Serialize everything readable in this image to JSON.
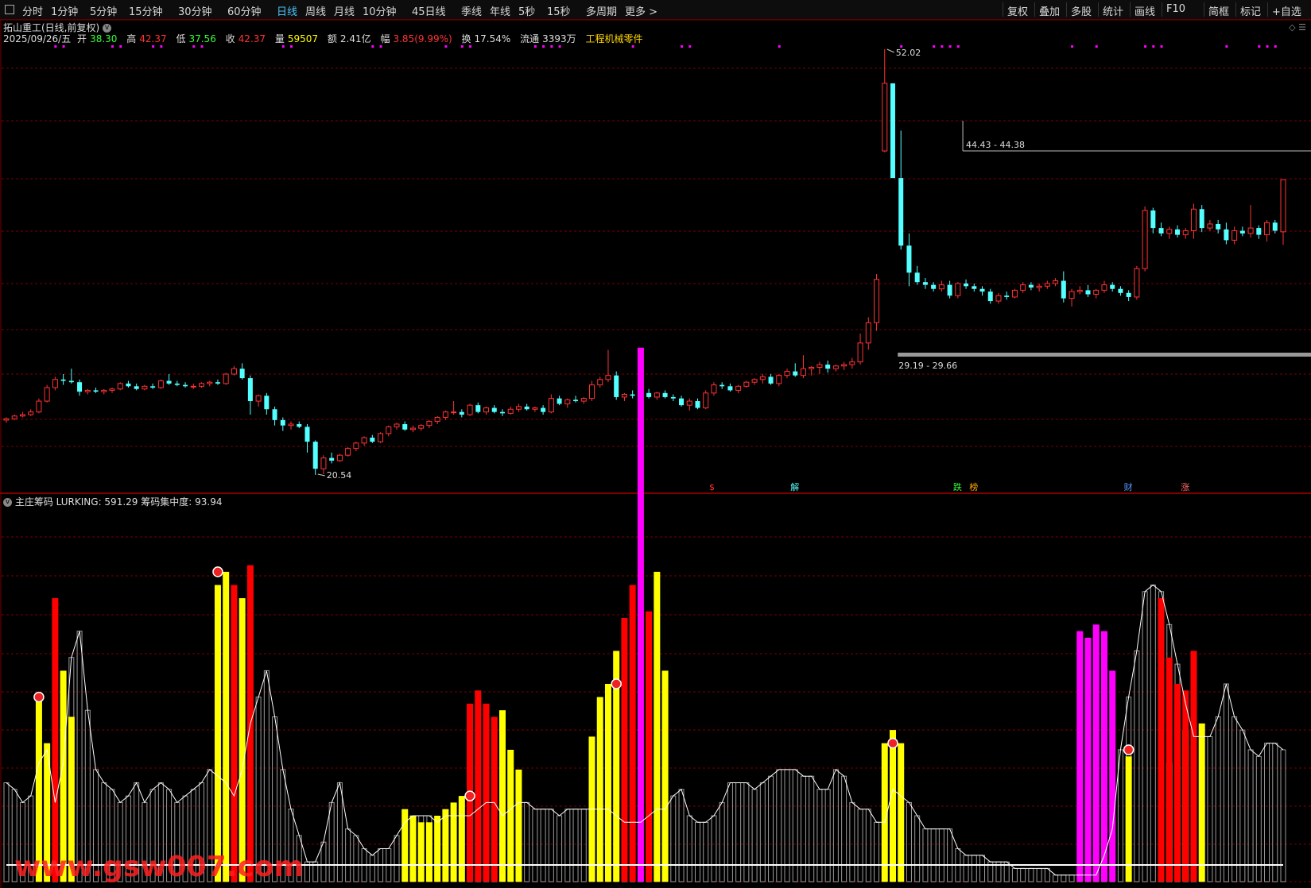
{
  "toolbar": {
    "periods": [
      "分时",
      "1分钟",
      "5分钟",
      "15分钟",
      "30分钟",
      "60分钟",
      "日线",
      "周线",
      "月线",
      "10分钟",
      "45日线",
      "季线",
      "年线",
      "5秒",
      "15秒",
      "多周期",
      "更多 >"
    ],
    "active_period": "日线",
    "right_buttons": [
      "复权",
      "叠加",
      "多股",
      "统计",
      "画线",
      "F10",
      "简框",
      "标记",
      "+自选"
    ]
  },
  "stock_header": {
    "title": "拓山重工(日线,前复权)",
    "date": "2025/09/26/五",
    "open_label": "开",
    "open": "38.30",
    "high_label": "高",
    "high": "42.37",
    "low_label": "低",
    "low": "37.56",
    "close_label": "收",
    "close": "42.37",
    "volume_label": "量",
    "volume": "59507",
    "amount_label": "额",
    "amount": "2.41亿",
    "change_label": "幅",
    "change": "3.85(9.99%)",
    "turnover_label": "换",
    "turnover": "17.54%",
    "float_label": "流通",
    "float": "3393万",
    "industry": "工程机械零件"
  },
  "colors": {
    "up": "#ff3333",
    "down": "#54ffff",
    "grid": "#7a0000",
    "yellow": "#ffff00",
    "magenta": "#ff00ff",
    "red_bar": "#ff0000",
    "gray_bar": "#9a9a9a",
    "line": "#ffffff"
  },
  "price_annotations": {
    "max_label": "52.02",
    "min_label": "20.54",
    "band_upper": "44.43 - 44.38",
    "band_lower": "29.19 - 29.66"
  },
  "event_markers": [
    "$",
    "解",
    "跌",
    "榜",
    "财",
    "涨"
  ],
  "sub_chart": {
    "title": "主庄筹码",
    "indicator": "LURKING: 591.29",
    "concentration": "筹码集中度: 93.94"
  },
  "watermark": "www.gsw007.com",
  "chart_data": {
    "type": "candlestick",
    "ohlc": [
      [
        24.6,
        24.8,
        24.4,
        24.7
      ],
      [
        24.7,
        25.0,
        24.6,
        24.9
      ],
      [
        24.9,
        25.2,
        24.8,
        25.0
      ],
      [
        25.0,
        25.4,
        24.9,
        25.2
      ],
      [
        25.2,
        26.2,
        25.1,
        26.0
      ],
      [
        26.0,
        27.2,
        25.9,
        27.0
      ],
      [
        27.0,
        27.8,
        26.8,
        27.6
      ],
      [
        27.6,
        28.0,
        27.2,
        27.5
      ],
      [
        27.5,
        28.4,
        27.3,
        27.4
      ],
      [
        27.4,
        27.6,
        26.4,
        26.7
      ],
      [
        26.7,
        26.9,
        26.5,
        26.8
      ],
      [
        26.8,
        27.0,
        26.6,
        26.7
      ],
      [
        26.7,
        26.9,
        26.5,
        26.8
      ],
      [
        26.8,
        27.0,
        26.6,
        26.9
      ],
      [
        26.9,
        27.4,
        26.8,
        27.3
      ],
      [
        27.3,
        27.5,
        27.0,
        27.1
      ],
      [
        27.1,
        27.3,
        26.8,
        26.9
      ],
      [
        26.9,
        27.2,
        26.8,
        27.1
      ],
      [
        27.1,
        27.3,
        26.9,
        27.0
      ],
      [
        27.0,
        27.6,
        26.9,
        27.5
      ],
      [
        27.5,
        28.0,
        27.2,
        27.3
      ],
      [
        27.3,
        27.5,
        27.1,
        27.2
      ],
      [
        27.2,
        27.4,
        27.0,
        27.1
      ],
      [
        27.1,
        27.3,
        26.9,
        27.1
      ],
      [
        27.1,
        27.4,
        27.0,
        27.3
      ],
      [
        27.3,
        27.5,
        27.1,
        27.4
      ],
      [
        27.4,
        27.6,
        27.2,
        27.3
      ],
      [
        27.3,
        28.1,
        27.2,
        28.0
      ],
      [
        28.0,
        28.6,
        27.9,
        28.4
      ],
      [
        28.4,
        28.8,
        27.6,
        27.7
      ],
      [
        27.7,
        27.9,
        25.0,
        26.0
      ],
      [
        26.0,
        26.5,
        25.6,
        26.4
      ],
      [
        26.4,
        26.6,
        25.0,
        25.4
      ],
      [
        25.4,
        25.6,
        24.2,
        24.6
      ],
      [
        24.6,
        24.8,
        23.8,
        24.2
      ],
      [
        24.2,
        24.5,
        23.9,
        24.3
      ],
      [
        24.3,
        24.5,
        24.0,
        24.1
      ],
      [
        24.1,
        24.3,
        22.2,
        23.0
      ],
      [
        23.0,
        23.1,
        20.54,
        21.0
      ],
      [
        21.0,
        22.0,
        20.6,
        21.8
      ],
      [
        21.8,
        22.2,
        21.4,
        21.6
      ],
      [
        21.6,
        22.1,
        21.5,
        22.0
      ],
      [
        22.0,
        22.6,
        21.9,
        22.5
      ],
      [
        22.5,
        23.0,
        22.3,
        22.9
      ],
      [
        22.9,
        23.4,
        22.7,
        23.3
      ],
      [
        23.3,
        23.5,
        22.9,
        23.0
      ],
      [
        23.0,
        23.7,
        22.9,
        23.6
      ],
      [
        23.6,
        24.2,
        23.4,
        24.1
      ],
      [
        24.1,
        24.4,
        23.9,
        24.3
      ],
      [
        24.3,
        24.5,
        23.8,
        23.9
      ],
      [
        23.9,
        24.2,
        23.7,
        24.0
      ],
      [
        24.0,
        24.3,
        23.8,
        24.2
      ],
      [
        24.2,
        24.6,
        24.0,
        24.5
      ],
      [
        24.5,
        24.9,
        24.3,
        24.8
      ],
      [
        24.8,
        25.3,
        24.6,
        25.2
      ],
      [
        25.2,
        26.0,
        25.0,
        25.2
      ],
      [
        25.2,
        25.4,
        24.8,
        25.0
      ],
      [
        25.0,
        25.8,
        24.9,
        25.7
      ],
      [
        25.7,
        25.9,
        25.1,
        25.2
      ],
      [
        25.2,
        25.6,
        25.0,
        25.5
      ],
      [
        25.5,
        25.7,
        25.1,
        25.2
      ],
      [
        25.2,
        25.4,
        24.9,
        25.1
      ],
      [
        25.1,
        25.6,
        25.0,
        25.4
      ],
      [
        25.4,
        25.8,
        25.2,
        25.6
      ],
      [
        25.6,
        25.8,
        25.3,
        25.4
      ],
      [
        25.4,
        25.6,
        25.2,
        25.5
      ],
      [
        25.5,
        25.7,
        25.0,
        25.2
      ],
      [
        25.2,
        26.5,
        25.1,
        26.2
      ],
      [
        26.2,
        26.4,
        25.7,
        25.8
      ],
      [
        25.8,
        26.2,
        25.5,
        26.1
      ],
      [
        26.1,
        26.4,
        25.9,
        26.0
      ],
      [
        26.0,
        26.3,
        25.8,
        26.2
      ],
      [
        26.2,
        27.5,
        26.0,
        27.2
      ],
      [
        27.2,
        27.8,
        27.0,
        27.6
      ],
      [
        27.6,
        29.8,
        27.4,
        27.9
      ],
      [
        27.9,
        28.2,
        26.1,
        26.3
      ],
      [
        26.3,
        26.6,
        26.0,
        26.5
      ],
      [
        26.5,
        26.8,
        26.2,
        26.4
      ],
      [
        26.4,
        26.7,
        26.1,
        26.6
      ],
      [
        26.6,
        26.9,
        26.2,
        26.3
      ],
      [
        26.3,
        26.7,
        26.1,
        26.6
      ],
      [
        26.6,
        26.8,
        26.2,
        26.3
      ],
      [
        26.3,
        26.5,
        26.0,
        26.2
      ],
      [
        26.2,
        26.4,
        25.6,
        25.7
      ],
      [
        25.7,
        26.2,
        25.3,
        26.0
      ],
      [
        26.0,
        26.2,
        25.4,
        25.5
      ],
      [
        25.5,
        26.8,
        25.4,
        26.6
      ],
      [
        26.6,
        27.4,
        26.4,
        27.2
      ],
      [
        27.2,
        27.4,
        26.9,
        27.1
      ],
      [
        27.1,
        27.3,
        26.7,
        26.8
      ],
      [
        26.8,
        27.2,
        26.6,
        27.1
      ],
      [
        27.1,
        27.5,
        27.0,
        27.4
      ],
      [
        27.4,
        27.7,
        27.2,
        27.6
      ],
      [
        27.6,
        28.0,
        27.3,
        27.8
      ],
      [
        27.8,
        28.0,
        27.2,
        27.3
      ],
      [
        27.3,
        28.0,
        27.1,
        27.9
      ],
      [
        27.9,
        28.4,
        27.7,
        28.2
      ],
      [
        28.2,
        28.8,
        27.8,
        27.9
      ],
      [
        27.9,
        29.4,
        27.7,
        28.4
      ],
      [
        28.4,
        28.6,
        27.9,
        28.5
      ],
      [
        28.5,
        28.9,
        28.0,
        28.7
      ],
      [
        28.7,
        29.0,
        28.1,
        28.4
      ],
      [
        28.4,
        28.7,
        28.2,
        28.6
      ],
      [
        28.6,
        28.9,
        28.3,
        28.7
      ],
      [
        28.7,
        29.2,
        28.4,
        28.9
      ],
      [
        28.9,
        31.0,
        28.7,
        30.3
      ],
      [
        30.3,
        32.2,
        29.8,
        31.8
      ],
      [
        31.8,
        35.4,
        31.2,
        35.0
      ],
      [
        44.5,
        52.02,
        44.4,
        49.5
      ],
      [
        49.5,
        49.5,
        42.5,
        42.5
      ],
      [
        42.5,
        46.0,
        37.2,
        37.5
      ],
      [
        37.5,
        38.4,
        34.5,
        35.5
      ],
      [
        35.5,
        36.0,
        34.6,
        34.8
      ],
      [
        34.8,
        35.1,
        34.3,
        34.6
      ],
      [
        34.6,
        34.8,
        34.1,
        34.3
      ],
      [
        34.3,
        34.9,
        34.1,
        34.6
      ],
      [
        34.6,
        34.9,
        33.6,
        33.8
      ],
      [
        33.8,
        34.8,
        33.6,
        34.7
      ],
      [
        34.7,
        35.0,
        34.3,
        34.5
      ],
      [
        34.5,
        34.7,
        34.1,
        34.3
      ],
      [
        34.3,
        34.5,
        33.8,
        34.1
      ],
      [
        34.1,
        34.3,
        33.2,
        33.4
      ],
      [
        33.4,
        34.0,
        33.2,
        33.8
      ],
      [
        33.8,
        34.1,
        33.5,
        33.7
      ],
      [
        33.7,
        34.3,
        33.6,
        34.2
      ],
      [
        34.2,
        34.8,
        34.0,
        34.6
      ],
      [
        34.6,
        34.8,
        34.2,
        34.4
      ],
      [
        34.4,
        34.7,
        34.1,
        34.5
      ],
      [
        34.5,
        34.9,
        34.3,
        34.7
      ],
      [
        34.7,
        35.1,
        34.5,
        34.9
      ],
      [
        34.9,
        35.6,
        33.3,
        33.6
      ],
      [
        33.6,
        34.3,
        33.0,
        34.1
      ],
      [
        34.1,
        34.5,
        33.9,
        34.2
      ],
      [
        34.2,
        34.6,
        33.7,
        33.9
      ],
      [
        33.9,
        34.3,
        33.6,
        34.2
      ],
      [
        34.2,
        34.9,
        34.0,
        34.6
      ],
      [
        34.6,
        34.8,
        34.1,
        34.3
      ],
      [
        34.3,
        34.5,
        33.8,
        34.0
      ],
      [
        34.0,
        34.2,
        33.4,
        33.7
      ],
      [
        33.7,
        36.0,
        33.5,
        35.8
      ],
      [
        35.8,
        40.4,
        35.6,
        40.1
      ],
      [
        40.1,
        40.3,
        38.4,
        38.8
      ],
      [
        38.8,
        39.2,
        38.2,
        38.4
      ],
      [
        38.4,
        38.9,
        38.0,
        38.7
      ],
      [
        38.7,
        39.0,
        38.1,
        38.3
      ],
      [
        38.3,
        38.8,
        38.0,
        38.6
      ],
      [
        38.6,
        40.6,
        38.0,
        40.2
      ],
      [
        40.2,
        40.5,
        38.5,
        38.8
      ],
      [
        38.8,
        39.4,
        38.6,
        39.1
      ],
      [
        39.1,
        39.4,
        38.4,
        38.7
      ],
      [
        38.7,
        39.2,
        37.6,
        37.9
      ],
      [
        37.9,
        38.9,
        37.6,
        38.6
      ],
      [
        38.6,
        38.9,
        38.2,
        38.4
      ],
      [
        38.4,
        40.5,
        38.1,
        38.8
      ],
      [
        38.8,
        39.0,
        38.0,
        38.3
      ],
      [
        38.3,
        39.4,
        37.8,
        39.2
      ],
      [
        39.2,
        39.4,
        38.4,
        38.6
      ],
      [
        38.52,
        42.37,
        37.56,
        42.37
      ]
    ],
    "lurking": [
      15,
      14,
      12,
      13,
      18,
      20,
      12,
      18,
      34,
      38,
      26,
      17,
      15,
      14,
      12,
      13,
      15,
      12,
      14,
      15,
      14,
      12,
      13,
      14,
      15,
      17,
      16,
      15,
      13,
      17,
      24,
      28,
      32,
      25,
      17,
      11,
      7,
      3,
      3,
      6,
      12,
      15,
      8,
      7,
      5,
      4,
      5,
      5,
      7,
      9,
      10,
      10,
      10,
      9,
      10,
      10,
      10,
      10,
      11,
      12,
      12,
      10,
      11,
      12,
      12,
      11,
      11,
      11,
      10,
      11,
      11,
      11,
      11,
      11,
      11,
      10,
      9,
      9,
      9,
      10,
      11,
      11,
      13,
      14,
      10,
      9,
      9,
      10,
      12,
      15,
      15,
      15,
      14,
      15,
      16,
      17,
      17,
      17,
      16,
      16,
      14,
      14,
      17,
      16,
      12,
      11,
      11,
      9,
      9,
      14,
      13,
      12,
      10,
      8,
      8,
      8,
      8,
      5,
      4,
      4,
      4,
      3,
      3,
      3,
      2,
      2,
      2,
      2,
      2,
      1,
      1,
      1,
      1,
      1,
      1,
      4,
      8,
      20,
      28,
      35,
      44,
      45,
      44,
      39,
      33,
      27,
      22,
      22,
      22,
      25,
      30,
      25,
      23,
      20,
      19,
      21,
      21,
      20,
      22
    ],
    "yellow_bars": {
      "4": 28,
      "5": 21,
      "7": 32,
      "8": 25,
      "26": 45,
      "27": 47,
      "29": 43,
      "49": 11,
      "50": 10,
      "51": 9,
      "52": 9,
      "53": 10,
      "54": 11,
      "55": 12,
      "56": 13,
      "61": 26,
      "62": 20,
      "63": 17,
      "72": 22,
      "73": 28,
      "74": 30,
      "75": 35,
      "80": 47,
      "81": 32,
      "108": 21,
      "109": 23,
      "110": 21,
      "138": 19,
      "143": 18,
      "144": 26,
      "145": 23,
      "147": 24
    },
    "red_bars": {
      "6": 43,
      "28": 45,
      "30": 48,
      "57": 27,
      "58": 29,
      "59": 27,
      "60": 25,
      "76": 40,
      "77": 45,
      "79": 41,
      "142": 43,
      "143": 34,
      "144": 30,
      "145": 29,
      "146": 35
    },
    "magenta_bars": {
      "78": 81,
      "132": 38,
      "133": 37,
      "134": 39,
      "135": 38,
      "136": 32
    }
  }
}
